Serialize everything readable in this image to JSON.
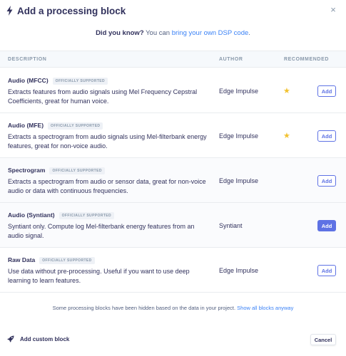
{
  "dialog": {
    "title": "Add a processing block",
    "close_glyph": "×",
    "icon": "bolt-icon"
  },
  "tip": {
    "lead": "Did you know?",
    "text": " You can ",
    "link": "bring your own DSP code",
    "end": "."
  },
  "table": {
    "headers": {
      "description": "DESCRIPTION",
      "author": "AUTHOR",
      "recommended": "RECOMMENDED"
    },
    "badge_label": "OFFICIALLY SUPPORTED",
    "add_label": "Add",
    "star_glyph": "★",
    "rows": [
      {
        "name": "Audio (MFCC)",
        "description": "Extracts features from audio signals using Mel Frequency Cepstral Coefficients, great for human voice.",
        "author": "Edge Impulse",
        "recommended": true,
        "highlighted_add": false
      },
      {
        "name": "Audio (MFE)",
        "description": "Extracts a spectrogram from audio signals using Mel-filterbank energy features, great for non-voice audio.",
        "author": "Edge Impulse",
        "recommended": true,
        "highlighted_add": false
      },
      {
        "name": "Spectrogram",
        "description": "Extracts a spectrogram from audio or sensor data, great for non-voice audio or data with continuous frequencies.",
        "author": "Edge Impulse",
        "recommended": false,
        "highlighted_add": false
      },
      {
        "name": "Audio (Syntiant)",
        "description": "Syntiant only. Compute log Mel-filterbank energy features from an audio signal.",
        "author": "Syntiant",
        "recommended": false,
        "highlighted_add": true
      },
      {
        "name": "Raw Data",
        "description": "Use data without pre-processing. Useful if you want to use deep learning to learn features.",
        "author": "Edge Impulse",
        "recommended": false,
        "highlighted_add": false
      }
    ]
  },
  "hidden_note": {
    "text": "Some processing blocks have been hidden based on the data in your project. ",
    "link": "Show all blocks anyway"
  },
  "footer": {
    "custom_label": "Add custom block",
    "custom_icon": "rocket-icon",
    "cancel_label": "Cancel"
  },
  "colors": {
    "accent": "#5e72e4",
    "link": "#3b82f6",
    "star": "#f2c230",
    "text": "#32325d"
  }
}
